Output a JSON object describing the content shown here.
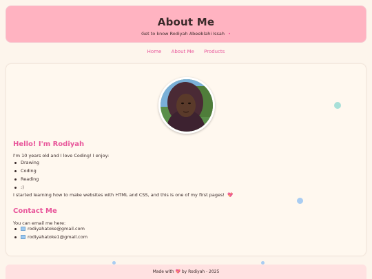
{
  "header": {
    "title": "About Me",
    "subtitle": "Get to know Rodiyah Abeeblahi Issah",
    "subtitle_dot": "•"
  },
  "nav": {
    "items": [
      "Home",
      "About Me",
      "Products"
    ]
  },
  "intro": {
    "heading": "Hello! I'm Rodiyah",
    "line": "I'm 10 years old and I love Coding! I enjoy:",
    "hobbies": [
      "Drawing",
      "Coding",
      "Reading",
      ":)"
    ],
    "closing": "I started learning how to make websites with HTML and CSS, and this is one of my first pages!",
    "heart": "💖"
  },
  "contact": {
    "heading": "Contact Me",
    "line": "You can email me here:",
    "emails": [
      "rodiyahatoke@gmail.com",
      "rodiyahatoke1@gmail.com"
    ]
  },
  "footer": {
    "text": "Made with 💖 by Rodiyah - 2025"
  },
  "colors": {
    "header_bg": "#ffb3c1",
    "accent": "#e8559a",
    "page_bg": "#fdf5ec"
  }
}
